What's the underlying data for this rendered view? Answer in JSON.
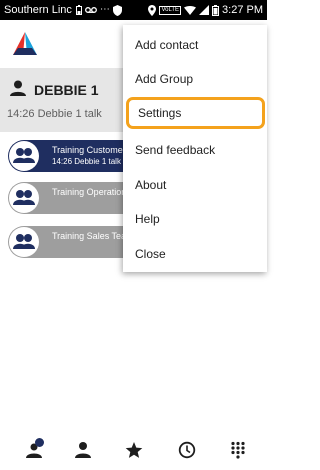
{
  "status_bar": {
    "carrier": "Southern Linc",
    "time": "3:27 PM",
    "icons": [
      "battery-saver-icon",
      "voicemail-icon",
      "more-icon",
      "shield-icon",
      "location-icon",
      "volte-icon",
      "wifi-icon",
      "signal-icon",
      "battery-icon"
    ],
    "volte_label": "VoLTE"
  },
  "user": {
    "name": "DEBBIE 1",
    "status_preview": "14:26 Debbie 1 talk"
  },
  "chats": [
    {
      "title": "Training Customer",
      "subtitle": "14:26 Debbie 1 talk",
      "active": true
    },
    {
      "title": "Training Operations",
      "subtitle": "",
      "active": false
    },
    {
      "title": "Training Sales Team",
      "subtitle": "",
      "active": false
    }
  ],
  "menu": {
    "items": [
      "Add contact",
      "Add Group",
      "Settings",
      "Send feedback",
      "About",
      "Help",
      "Close"
    ],
    "highlighted": "Settings"
  },
  "bottom_nav": {
    "items": [
      "groups-icon",
      "contacts-icon",
      "favorites-icon",
      "recent-icon",
      "dialpad-icon"
    ],
    "badge": ""
  },
  "colors": {
    "primary_navy": "#1f2e60",
    "highlight_orange": "#f4a21c",
    "inactive_grey": "#9e9e9e",
    "card_grey": "#e6e6e6"
  }
}
